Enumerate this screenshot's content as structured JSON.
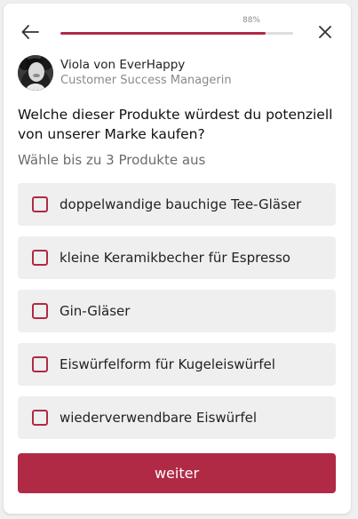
{
  "header": {
    "back_icon": "arrow-left-icon",
    "close_icon": "close-icon",
    "progress": {
      "label": "88%",
      "value": 0.88
    }
  },
  "agent": {
    "name": "Viola von EverHappy",
    "role": "Customer Success Managerin",
    "avatar_icon": "avatar"
  },
  "question": {
    "title": "Welche dieser Produkte würdest du potenziell von unserer Marke kaufen?",
    "hint": "Wähle bis zu 3 Produkte aus"
  },
  "options": [
    {
      "label": "doppelwandige bauchige Tee-Gläser"
    },
    {
      "label": "kleine Keramikbecher für Espresso"
    },
    {
      "label": "Gin-Gläser"
    },
    {
      "label": "Eiswürfelform für Kugeleiswürfel"
    },
    {
      "label": "wiederverwendbare Eiswürfel"
    }
  ],
  "submit": {
    "label": "weiter"
  },
  "colors": {
    "accent": "#b02a45",
    "option_bg": "#efefef",
    "track": "#dedede"
  }
}
